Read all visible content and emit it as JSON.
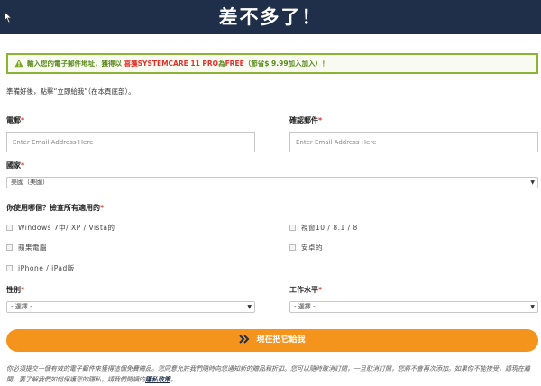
{
  "header": {
    "title": "差不多了！"
  },
  "notice": {
    "text_before": "輸入您的電子郵件地址，獲得以",
    "highlight1": " 喜獲SYSTEMCARE 11 PRO",
    "text_middle": "為",
    "highlight2": "FREE",
    "text_after": "（節省$ 9.99加入加入）！"
  },
  "instructions": "準備好後，點擊“立即給我”（在本頁底部）。",
  "form": {
    "email_label": "電郵",
    "email_placeholder": "Enter Email Address Here",
    "confirm_email_label": "確認郵件",
    "confirm_email_placeholder": "Enter Email Address Here",
    "country_label": "國家",
    "country_value": "美國（美國）",
    "os_question": "你使用哪個？檢查所有適用的",
    "os_options": [
      "Windows 7中/ XP / Vista的",
      "視窗10 / 8.1 / 8",
      "蘋果電腦",
      "安卓的",
      "iPhone / iPad版"
    ],
    "gender_label": "性別",
    "gender_value": "- 選擇 -",
    "job_level_label": "工作水平",
    "job_level_value": "- 選擇 -",
    "required_mark": "*",
    "arrow_glyph": "▼"
  },
  "cta": {
    "label": "現在把它給我"
  },
  "disclaimer": {
    "text": "你必須提交一個有效的電子郵件來獲得這個免費贈品。您同意允許我們隨時向您通知新的贈品和折扣。您可以隨時取消訂閱，一旦取消訂閱，您將不會再次添加。如果你不能接受，請現在離開。要了解我們如何保護您的隱私，請我們閱讀的",
    "link": "隱私政策",
    "end": "。"
  },
  "colors": {
    "header_bg": "#1f2f49",
    "notice_border": "#8ab431",
    "notice_text": "#5a8a1c",
    "highlight": "#e2322b",
    "cta_bg": "#f5941d"
  }
}
